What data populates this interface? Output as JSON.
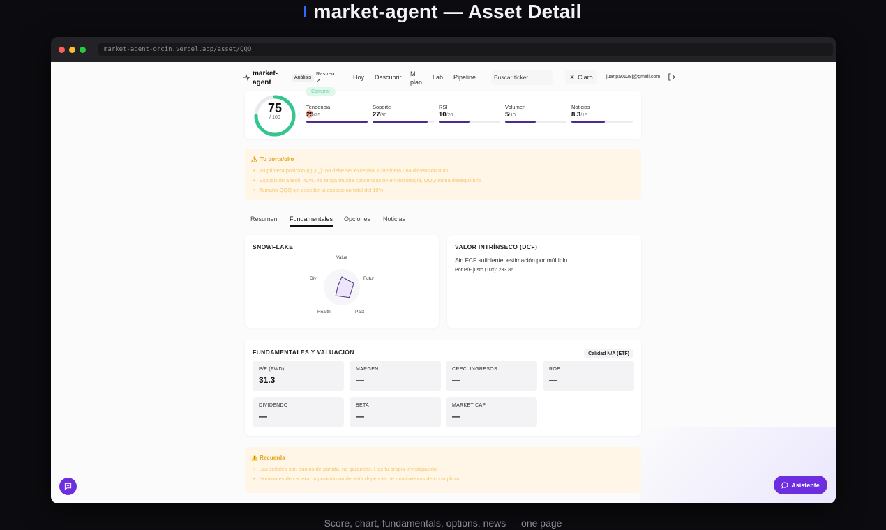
{
  "header": {
    "title": "market-agent — Asset Detail",
    "caption": "Score, chart, fundamentals, options, news — one page"
  },
  "browser": {
    "url": "market-agent-orcin.vercel.app/asset/QQQ"
  },
  "nav": {
    "logo_text": "market-agent",
    "analysis_pill": "Análisis",
    "tracking_link": "Rastreo ↗",
    "links": [
      "Hoy",
      "Descubrir",
      "Mi plan",
      "Lab",
      "Pipeline"
    ],
    "search_placeholder": "Buscar ticker...",
    "theme_label": "Claro",
    "user_email": "juanpa0128j@gmail.com"
  },
  "score": {
    "badge": "Comprar",
    "value": "75",
    "max_label": "/ 100",
    "fraction": 0.75,
    "metrics": [
      {
        "label": "Tendencia",
        "score": "25",
        "max": "/25",
        "fraction": 1.0
      },
      {
        "label": "Soporte",
        "score": "27",
        "max": "/30",
        "fraction": 0.9
      },
      {
        "label": "RSI",
        "score": "10",
        "max": "/20",
        "fraction": 0.5
      },
      {
        "label": "Volumen",
        "score": "5",
        "max": "/10",
        "fraction": 0.5
      },
      {
        "label": "Noticias",
        "score": "8.3",
        "max": "/15",
        "fraction": 0.55
      }
    ]
  },
  "portfolio": {
    "title": "Tu portafolio",
    "bullets": [
      "Tu primera posición (QQQ): no debe ser excesiva. Considera una dimensión más",
      "Exposición a tech: 42%. Ya tenga mucha concentración en tecnología, QQQ suma desequilibrio",
      "Tamaño QQQ sin exceder la exposición total del 10%"
    ],
    "accent_color": "#e0a219"
  },
  "tabs": [
    "Resumen",
    "Fundamentales",
    "Opciones",
    "Noticias"
  ],
  "active_tab": "Fundamentales",
  "snowflake": {
    "title": "SNOWFLAKE",
    "axes": [
      "Value",
      "Futur",
      "Past",
      "Health",
      "Div"
    ],
    "scores": [
      0.25,
      0.3,
      0.3,
      0.25,
      0.1
    ]
  },
  "dcf": {
    "title": "VALOR INTRÍNSECO (DCF)",
    "text": "Sin FCF suficiente; estimación por múltiplo.",
    "sub": "Por P/E justo (10x): 233.86"
  },
  "fundamentals": {
    "title": "FUNDAMENTALES Y VALUACIÓN",
    "quality_badge": "Calidad N/A (ETF)",
    "metrics": [
      {
        "label": "P/E (FWD)",
        "value": "31.3"
      },
      {
        "label": "MARGEN",
        "value": "—"
      },
      {
        "label": "CREC. INGRESOS",
        "value": "—"
      },
      {
        "label": "ROE",
        "value": "—"
      },
      {
        "label": "DIVIDENDO",
        "value": "—"
      },
      {
        "label": "BETA",
        "value": "—"
      },
      {
        "label": "MARKET CAP",
        "value": "—"
      }
    ]
  },
  "remember": {
    "title": "⚠️ Recuerda",
    "bullets": [
      "Las señales son puntos de partida, no garantías. Haz tu propia investigación",
      "Horizontes de cartera: la posición no debería depender de movimientos de corto plazo"
    ]
  },
  "assistant_label": "Asistente",
  "colors": {
    "accent": "#6d2ee0",
    "gauge": "#34c68f",
    "bar": "#4c2b8f"
  }
}
